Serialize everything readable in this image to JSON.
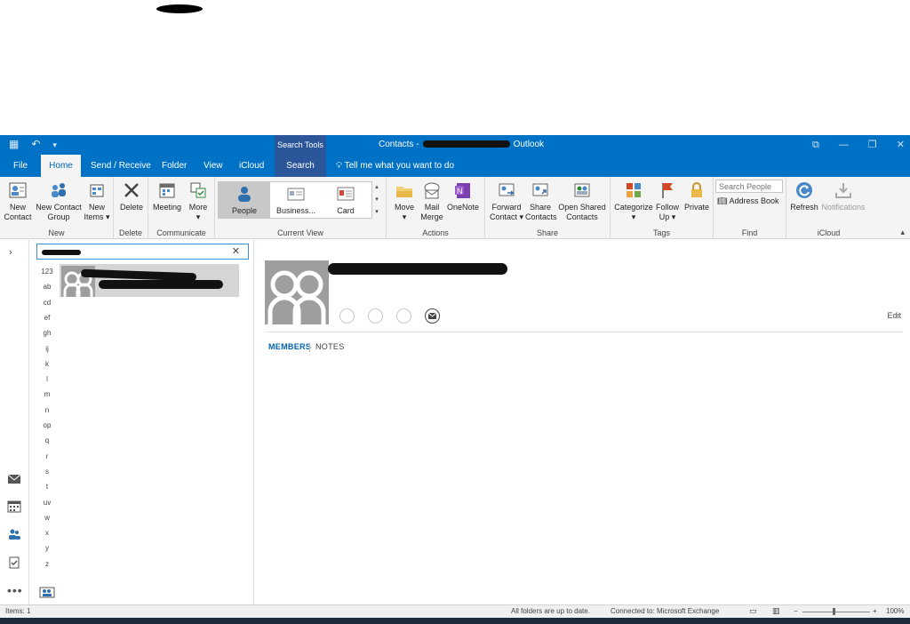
{
  "titlebar": {
    "context_tab": "Search Tools",
    "window_title_prefix": "Contacts -",
    "window_title_suffix": "Outlook"
  },
  "tabs": [
    "File",
    "Home",
    "Send / Receive",
    "Folder",
    "View",
    "iCloud",
    "Search"
  ],
  "active_tab": "Home",
  "tell_me": "Tell me what you want to do",
  "ribbon": {
    "new": {
      "label": "New",
      "new_contact": [
        "New",
        "Contact"
      ],
      "new_contact_group": [
        "New Contact",
        "Group"
      ],
      "new_items": [
        "New",
        "Items ▾"
      ]
    },
    "delete": {
      "label": "Delete",
      "delete": "Delete"
    },
    "communicate": {
      "label": "Communicate",
      "meeting": "Meeting",
      "more": [
        "More",
        "▾"
      ]
    },
    "current_view": {
      "label": "Current View",
      "people": "People",
      "business": "Business...",
      "card": "Card"
    },
    "actions": {
      "label": "Actions",
      "move": [
        "Move",
        "▾"
      ],
      "mail_merge": [
        "Mail",
        "Merge"
      ],
      "onenote": "OneNote"
    },
    "share": {
      "label": "Share",
      "forward_contact": [
        "Forward",
        "Contact ▾"
      ],
      "share_contacts": [
        "Share",
        "Contacts"
      ],
      "open_shared_contacts": [
        "Open Shared",
        "Contacts"
      ]
    },
    "tags": {
      "label": "Tags",
      "categorize": [
        "Categorize",
        "▾"
      ],
      "follow_up": [
        "Follow",
        "Up ▾"
      ],
      "private": "Private"
    },
    "find": {
      "label": "Find",
      "search_people": "Search People",
      "address_book": "Address Book"
    },
    "icloud": {
      "label": "iCloud",
      "refresh": "Refresh",
      "notifications": "Notifications"
    }
  },
  "alphabet_index": [
    "123",
    "ab",
    "cd",
    "ef",
    "gh",
    "ij",
    "k",
    "l",
    "m",
    "n",
    "op",
    "q",
    "r",
    "s",
    "t",
    "uv",
    "w",
    "x",
    "y",
    "z"
  ],
  "search_clear": "✕",
  "reading_pane": {
    "edit": "Edit",
    "tabs": [
      "MEMBERS",
      "NOTES"
    ],
    "active_tab": "MEMBERS"
  },
  "status": {
    "items": "Items: 1",
    "folders": "All folders are up to date.",
    "connection": "Connected to: Microsoft Exchange",
    "zoom": "100%"
  },
  "colors": {
    "accent": "#0072c6",
    "context_tab": "#2b579a",
    "ribbon_bg": "#f4f4f4",
    "link_blue": "#0063b1"
  },
  "icons": [
    "calendar-icon",
    "undo-icon",
    "customize-qat-icon",
    "lightbulb-icon",
    "mail-icon",
    "calendar-nav-icon",
    "people-icon",
    "tasks-icon",
    "more-icon",
    "new-contact-group-icon"
  ]
}
